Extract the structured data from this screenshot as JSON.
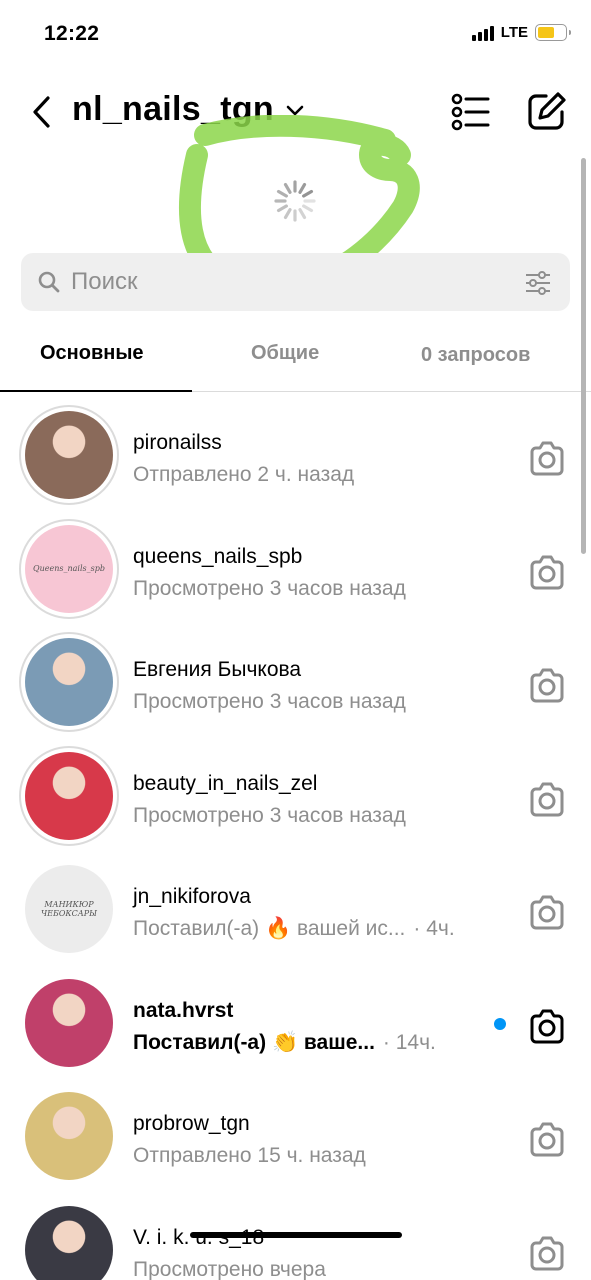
{
  "status_bar": {
    "time": "12:22",
    "network": "LTE",
    "battery_color": "#f5c518",
    "battery_level": 0.6
  },
  "header": {
    "account_name": "nl_nails_tgn",
    "back_icon": "chevron-left-icon",
    "dropdown_icon": "chevron-down-icon",
    "list_icon": "list-icon",
    "compose_icon": "compose-icon"
  },
  "annotation": {
    "color": "#8cd64a"
  },
  "search": {
    "placeholder": "Поиск",
    "value": ""
  },
  "tabs": [
    {
      "label": "Основные",
      "active": true
    },
    {
      "label": "Общие",
      "active": false
    },
    {
      "label": "0 запросов",
      "active": false
    }
  ],
  "chats": [
    {
      "name": "pironailss",
      "preview": "Отправлено 2 ч. назад",
      "time": "",
      "unread": false,
      "avatar_color": "#8a6a5a"
    },
    {
      "name": "queens_nails_spb",
      "preview": "Просмотрено 3 часов назад",
      "time": "",
      "unread": false,
      "avatar_color": "#f7c6d4",
      "avatar_text": "Queens_nails_spb"
    },
    {
      "name": "Евгения  Бычкова",
      "preview": "Просмотрено 3 часов назад",
      "time": "",
      "unread": false,
      "avatar_color": "#7b9bb5"
    },
    {
      "name": "beauty_in_nails_zel",
      "preview": "Просмотрено 3 часов назад",
      "time": "",
      "unread": false,
      "avatar_color": "#d7394a"
    },
    {
      "name": "jn_nikiforova",
      "preview": "Поставил(-а) 🔥 вашей ис...",
      "time": "· 4ч.",
      "unread": false,
      "avatar_color": "#ececec",
      "avatar_text": "МАНИКЮР ЧЕБОКСАРЫ"
    },
    {
      "name": "nata.hvrst",
      "preview": "Поставил(-а) 👏 ваше...",
      "time": "· 14ч.",
      "unread": true,
      "avatar_color": "#c0406a"
    },
    {
      "name": "probrow_tgn",
      "preview": "Отправлено 15 ч. назад",
      "time": "",
      "unread": false,
      "avatar_color": "#d9c07a"
    },
    {
      "name": "V. i. k. u. s_18",
      "preview": "Просмотрено вчера",
      "time": "",
      "unread": false,
      "avatar_color": "#3a3a44"
    }
  ],
  "colors": {
    "unread_dot": "#0095f6",
    "secondary_text": "#8e8e8e",
    "search_bg": "#efefef"
  }
}
